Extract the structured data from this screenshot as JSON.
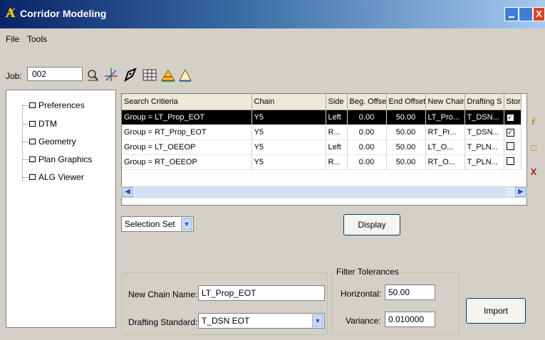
{
  "window": {
    "title": "Corridor Modeling",
    "close_glyph": "X"
  },
  "menu": [
    {
      "label": "File"
    },
    {
      "label": "Tools"
    }
  ],
  "toolbar": {
    "job_label": "Job:",
    "job_value": "002",
    "icons": [
      "search-icon",
      "axis-icon",
      "pen-icon",
      "grid-icon",
      "chart-icon",
      "triangle-icon"
    ]
  },
  "tree": {
    "items": [
      {
        "label": "Preferences"
      },
      {
        "label": "DTM"
      },
      {
        "label": "Geometry"
      },
      {
        "label": "Plan Graphics"
      },
      {
        "label": "ALG Viewer"
      }
    ]
  },
  "grid": {
    "columns": [
      "Search Critieria",
      "Chain",
      "Side",
      "Beg. Offse",
      "End Offset",
      "New Chain",
      "Drafting S",
      "Stor"
    ],
    "rows": [
      {
        "criteria": "Group = LT_Prop_EOT",
        "chain": "Y5",
        "side": "Left",
        "beg": "0.00",
        "end": "50.00",
        "new_chain": "LT_Pro...",
        "drafting": "T_DSN...",
        "store_checked": true,
        "selected": true
      },
      {
        "criteria": "Group = RT_Prop_EOT",
        "chain": "Y5",
        "side": "R...",
        "beg": "0.00",
        "end": "50.00",
        "new_chain": "RT_Pr...",
        "drafting": "T_DSN...",
        "store_checked": true,
        "selected": false
      },
      {
        "criteria": "Group = LT_OEEOP",
        "chain": "Y5",
        "side": "Left",
        "beg": "0.00",
        "end": "50.00",
        "new_chain": "LT_O...",
        "drafting": "T_PLN...",
        "store_checked": false,
        "selected": false
      },
      {
        "criteria": "Group = RT_OEEOP",
        "chain": "Y5",
        "side": "R...",
        "beg": "0.00",
        "end": "50.00",
        "new_chain": "RT_O...",
        "drafting": "T_PLN...",
        "store_checked": false,
        "selected": false
      }
    ]
  },
  "side_buttons": {
    "edit": "ŕ",
    "copy": "□",
    "delete": "X"
  },
  "selection_set": {
    "value": "Selection Set"
  },
  "display_button": "Display",
  "new_chain": {
    "label": "New Chain Name:",
    "value": "LT_Prop_EOT"
  },
  "drafting_standard": {
    "label": "Drafting Standard:",
    "value": "T_DSN EOT"
  },
  "filter": {
    "legend": "Filter Tolerances",
    "horizontal_label": "Horizontal:",
    "horizontal_value": "50.00",
    "variance_label": "Variance:",
    "variance_value": "0.010000"
  },
  "import_button": "Import"
}
